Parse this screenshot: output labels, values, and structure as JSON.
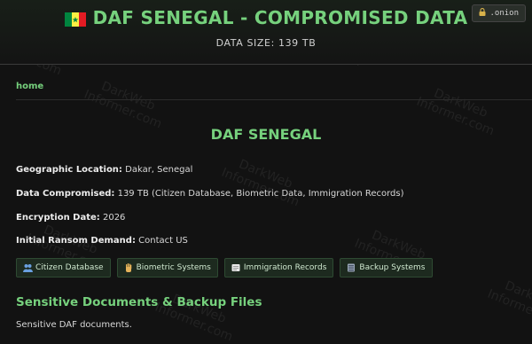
{
  "header": {
    "title": "DAF SENEGAL - COMPROMISED DATA",
    "subtitle": "DATA SIZE: 139 TB",
    "onion_badge": ".onion",
    "flag_colors": [
      "#00853F",
      "#FDEF42",
      "#E31B23"
    ]
  },
  "nav": {
    "home_label": "home"
  },
  "main": {
    "title": "DAF SENEGAL",
    "fields": [
      {
        "label": "Geographic Location:",
        "value": "Dakar, Senegal"
      },
      {
        "label": "Data Compromised:",
        "value": "139 TB (Citizen Database, Biometric Data, Immigration Records)"
      },
      {
        "label": "Encryption Date:",
        "value": "2026"
      },
      {
        "label": "Initial Ransom Demand:",
        "value": "Contact US"
      }
    ],
    "tags": [
      {
        "label": "Citizen Database",
        "icon": "people-icon"
      },
      {
        "label": "Biometric Systems",
        "icon": "hand-icon"
      },
      {
        "label": "Immigration Records",
        "icon": "document-icon"
      },
      {
        "label": "Backup Systems",
        "icon": "storage-icon"
      }
    ],
    "section_title": "Sensitive Documents & Backup Files",
    "section_text": "Sensitive DAF documents."
  },
  "watermark": {
    "line1": "DarkWeb",
    "line2": "Informer.com"
  },
  "colors": {
    "accent": "#76d17d",
    "background": "#121212",
    "tag_bg": "#1d2a1f"
  }
}
